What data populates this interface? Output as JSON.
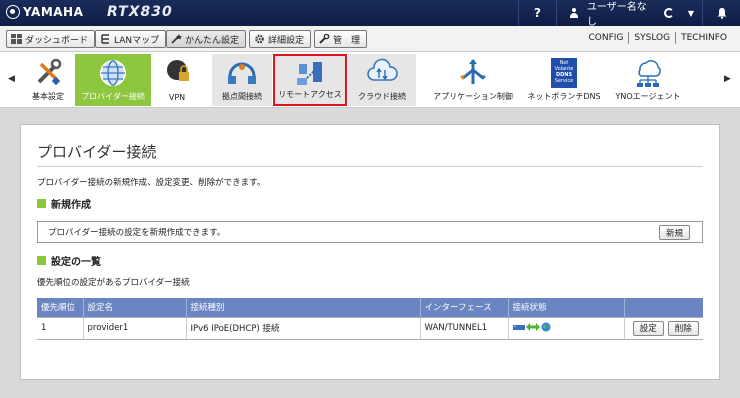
{
  "header": {
    "brand": "YAMAHA",
    "model": "RTX830",
    "help": "?",
    "user_label": "ユーザー名なし"
  },
  "nav": {
    "buttons": [
      {
        "label": "ダッシュボード",
        "icon": "dashboard-icon"
      },
      {
        "label": "LANマップ",
        "icon": "lanmap-icon"
      },
      {
        "label": "かんたん設定",
        "icon": "wizard-icon"
      },
      {
        "label": "詳細設定",
        "icon": "gear-icon"
      },
      {
        "label": "管　理",
        "icon": "wrench-icon"
      }
    ],
    "links": [
      "CONFIG",
      "SYSLOG",
      "TECHINFO"
    ]
  },
  "iconbar": {
    "left_arrow": "◀",
    "right_arrow": "▶",
    "items": [
      {
        "label": "基本設定",
        "icon": "tools-icon"
      },
      {
        "label": "プロバイダー接続",
        "icon": "globe-icon"
      },
      {
        "label": "VPN",
        "icon": "vpn-lock-icon"
      },
      {
        "label": "拠点間接続",
        "icon": "site-to-site-icon"
      },
      {
        "label": "リモートアクセス",
        "icon": "remote-access-icon"
      },
      {
        "label": "クラウド接続",
        "icon": "cloud-icon"
      },
      {
        "label": "アプリケーション制御",
        "icon": "app-control-icon"
      },
      {
        "label": "ネットボランチDNS",
        "icon": "ddns-service-icon",
        "icon_text": [
          "Net",
          "Volante",
          "DDNS",
          "Service"
        ]
      },
      {
        "label": "YNOエージェント",
        "icon": "yno-agent-icon"
      }
    ]
  },
  "page": {
    "title": "プロバイダー接続",
    "description": "プロバイダー接続の新規作成、設定変更、削除ができます。",
    "new_section": {
      "heading": "新規作成",
      "text": "プロバイダー接続の設定を新規作成できます。",
      "button": "新規"
    },
    "list_section": {
      "heading": "設定の一覧",
      "note": "優先順位の設定があるプロバイダー接続",
      "columns": [
        "優先順位",
        "設定名",
        "接続種別",
        "インターフェース",
        "接続状態",
        ""
      ],
      "rows": [
        {
          "priority": "1",
          "name": "provider1",
          "type": "IPv6 IPoE(DHCP) 接続",
          "interface": "WAN/TUNNEL1",
          "edit_button": "設定",
          "delete_button": "削除"
        }
      ]
    }
  },
  "colors": {
    "header_bg": "#15254f",
    "accent_green": "#8dc63f",
    "table_header": "#6b84c2",
    "highlight_red": "#e0141e"
  }
}
